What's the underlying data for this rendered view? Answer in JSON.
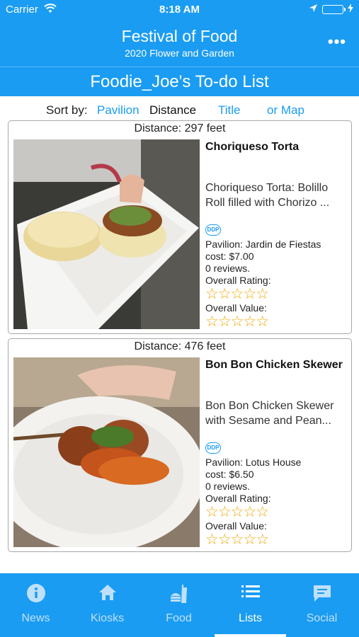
{
  "status": {
    "carrier": "Carrier",
    "time": "8:18 AM"
  },
  "nav": {
    "title": "Festival of Food",
    "subtitle": "2020 Flower and Garden"
  },
  "list": {
    "title": "Foodie_Joe's To-do List"
  },
  "sort": {
    "label": "Sort by:",
    "options": [
      "Pavilion",
      "Distance",
      "Title",
      "or Map"
    ],
    "active": "Distance"
  },
  "items": [
    {
      "distance": "Distance: 297 feet",
      "name": "Choriqueso Torta",
      "description": "Choriqueso Torta: Bolillo Roll filled with Chorizo ...",
      "badge": "DDP",
      "pavilion": "Pavilion: Jardin de Fiestas",
      "cost": "cost: $7.00",
      "reviews": "0 reviews.",
      "rating_label": "Overall Rating:",
      "value_label": "Overall Value:",
      "rating": 0,
      "value": 0
    },
    {
      "distance": "Distance: 476 feet",
      "name": "Bon Bon Chicken Skewer",
      "description": "Bon Bon Chicken Skewer with Sesame and Pean...",
      "badge": "DDP",
      "pavilion": "Pavilion: Lotus House",
      "cost": "cost: $6.50",
      "reviews": "0 reviews.",
      "rating_label": "Overall Rating:",
      "value_label": "Overall Value:",
      "rating": 0,
      "value": 0
    }
  ],
  "tabs": [
    {
      "label": "News",
      "icon": "info-icon"
    },
    {
      "label": "Kiosks",
      "icon": "home-icon"
    },
    {
      "label": "Food",
      "icon": "food-icon"
    },
    {
      "label": "Lists",
      "icon": "list-icon"
    },
    {
      "label": "Social",
      "icon": "chat-icon"
    }
  ],
  "active_tab": "Lists",
  "colors": {
    "primary": "#1a9cf2",
    "star": "#f0a500",
    "battery": "#4cd964"
  }
}
